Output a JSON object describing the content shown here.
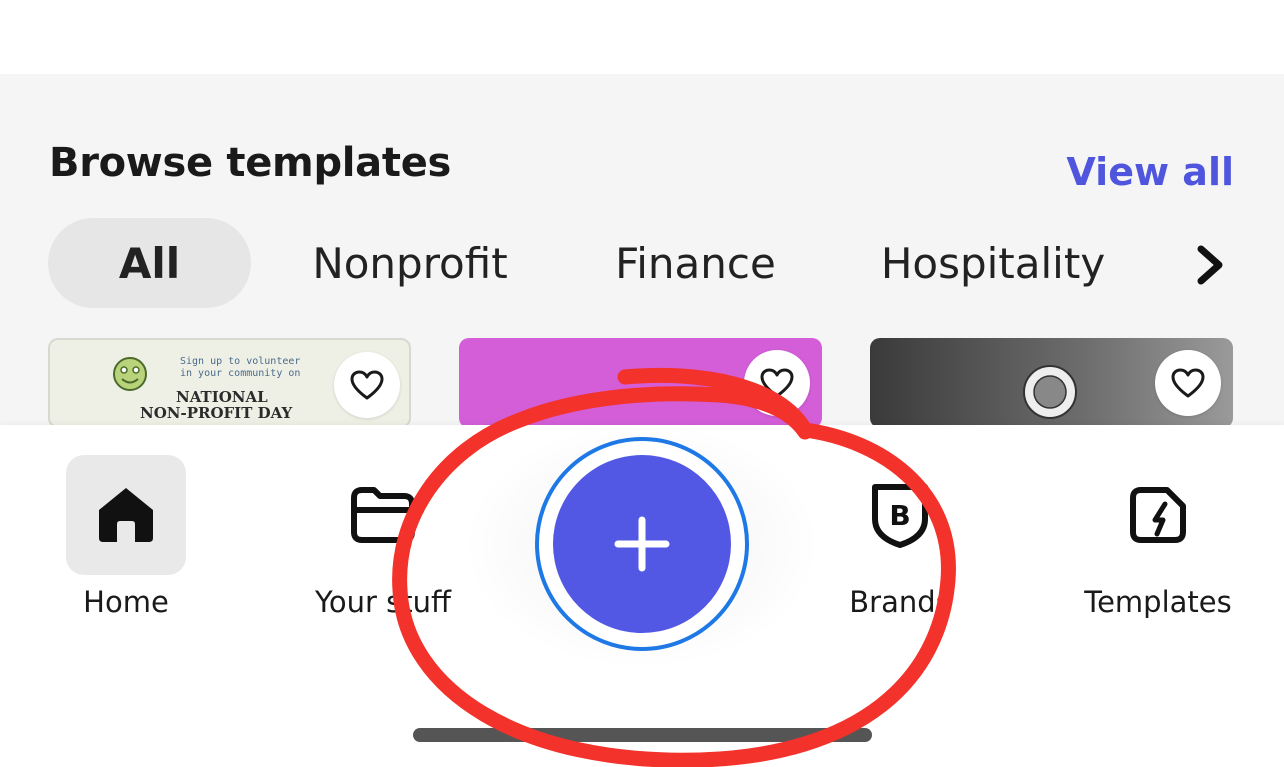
{
  "browse": {
    "title": "Browse templates",
    "view_all": "View all",
    "chips": [
      "All",
      "Nonprofit",
      "Finance",
      "Hospitality"
    ],
    "active_chip": "All",
    "more_icon": "chevron-right-icon"
  },
  "cards": [
    {
      "line1": "Sign up to volunteer",
      "line2": "in your community on",
      "line3": "NATIONAL",
      "line4": "NON-PROFIT DAY",
      "fav_icon": "heart-icon",
      "bg": "#eef0e6"
    },
    {
      "fav_icon": "heart-icon",
      "bg": "#d35ed8"
    },
    {
      "fav_icon": "heart-icon",
      "bg": "#5a5a5a"
    }
  ],
  "nav": {
    "items": [
      {
        "label": "Home",
        "icon": "home-icon",
        "active": true
      },
      {
        "label": "Your stuff",
        "icon": "folder-icon",
        "active": false
      },
      {
        "label": "Brands",
        "icon": "brand-icon",
        "active": false
      },
      {
        "label": "Templates",
        "icon": "templates-icon",
        "active": false
      }
    ],
    "create_icon": "plus-icon"
  },
  "colors": {
    "accent": "#5258e4",
    "link": "#4f56dd",
    "fab_ring": "#1e78e6",
    "annotation": "#f2322b"
  }
}
